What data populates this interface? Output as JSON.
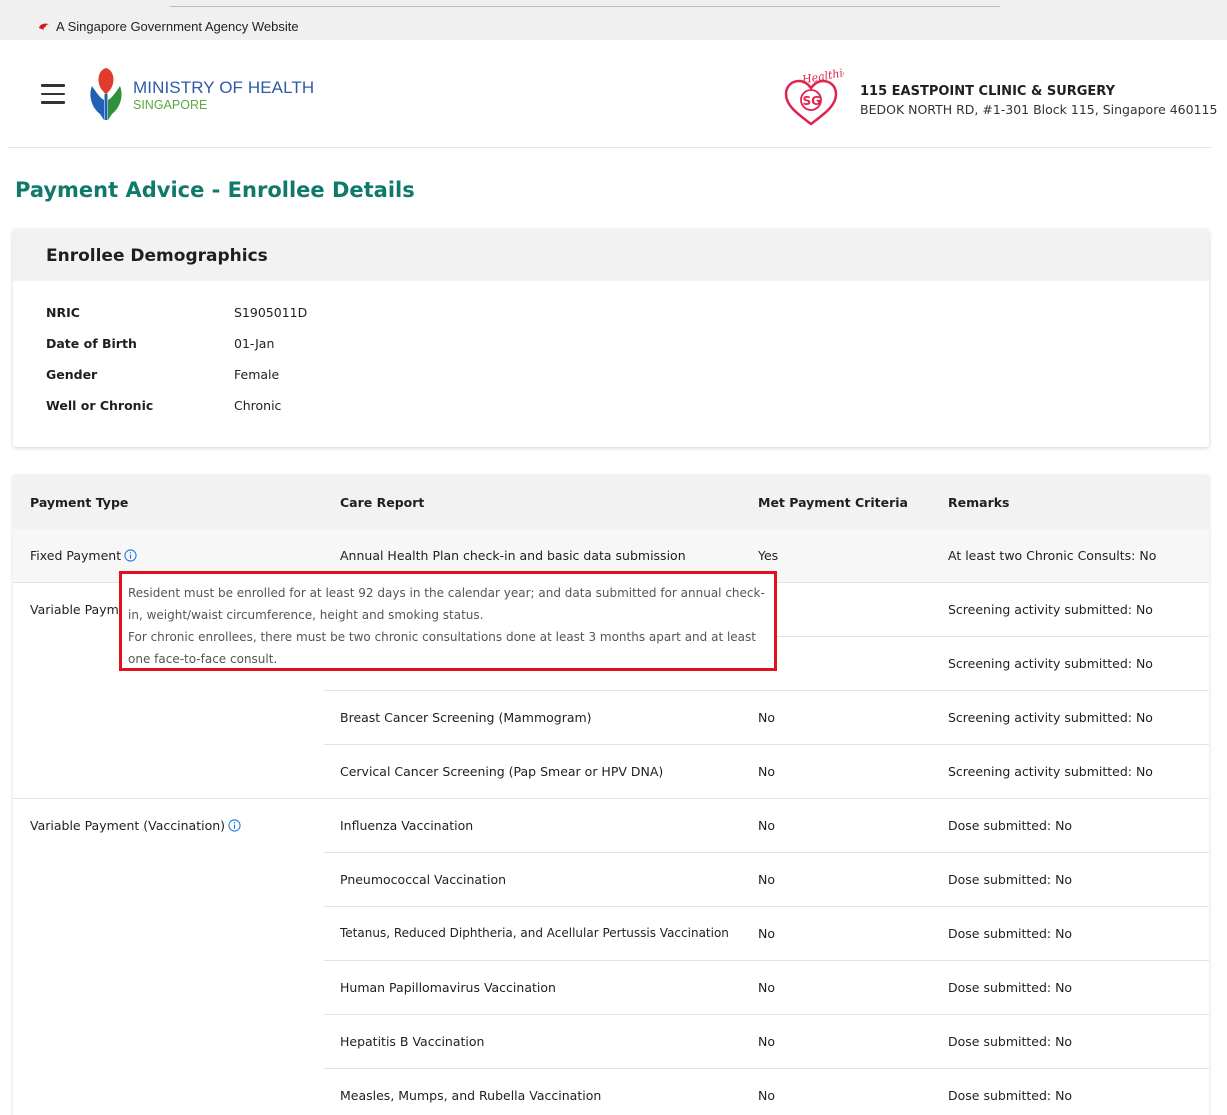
{
  "gov_banner": {
    "text": "A Singapore Government Agency Website"
  },
  "header": {
    "ministry_name": "MINISTRY OF HEALTH",
    "ministry_sub": "SINGAPORE",
    "healthier_logo_text": "Healthier",
    "healthier_logo_sg": "SG",
    "clinic_name": "115 EASTPOINT CLINIC & SURGERY",
    "clinic_address": "BEDOK NORTH RD, #1-301 Block 115, Singapore 460115"
  },
  "page_title": "Payment Advice - Enrollee Details",
  "demographics": {
    "title": "Enrollee Demographics",
    "fields": [
      {
        "label": "NRIC",
        "value": "S1905011D"
      },
      {
        "label": "Date of Birth",
        "value": "01-Jan"
      },
      {
        "label": "Gender",
        "value": "Female"
      },
      {
        "label": "Well or Chronic",
        "value": "Chronic"
      }
    ]
  },
  "table": {
    "headers": [
      "Payment Type",
      "Care Report",
      "Met Payment Criteria",
      "Remarks"
    ],
    "groups": [
      {
        "label": "Fixed Payment",
        "has_info": true
      },
      {
        "label": "Variable Payment",
        "has_info": true
      },
      {
        "label": "Variable Payment (Vaccination)",
        "has_info": true
      }
    ],
    "rows": [
      {
        "care_report": "Annual Health Plan check-in and basic data submission",
        "met": "Yes",
        "remarks": "At least two Chronic Consults: No"
      },
      {
        "care_report": "",
        "met": "",
        "remarks": "Screening activity submitted: No"
      },
      {
        "care_report": "",
        "met": "",
        "remarks": "Screening activity submitted: No"
      },
      {
        "care_report": "Breast Cancer Screening (Mammogram)",
        "met": "No",
        "remarks": "Screening activity submitted: No"
      },
      {
        "care_report": "Cervical Cancer Screening (Pap Smear or HPV DNA)",
        "met": "No",
        "remarks": "Screening activity submitted: No"
      },
      {
        "care_report": "Influenza Vaccination",
        "met": "No",
        "remarks": "Dose submitted: No"
      },
      {
        "care_report": "Pneumococcal Vaccination",
        "met": "No",
        "remarks": "Dose submitted: No"
      },
      {
        "care_report": "Tetanus, Reduced Diphtheria, and Acellular Pertussis Vaccination",
        "met": "No",
        "remarks": "Dose submitted: No"
      },
      {
        "care_report": "Human Papillomavirus Vaccination",
        "met": "No",
        "remarks": "Dose submitted: No"
      },
      {
        "care_report": "Hepatitis B Vaccination",
        "met": "No",
        "remarks": "Dose submitted: No"
      },
      {
        "care_report": "Measles, Mumps, and Rubella Vaccination",
        "met": "No",
        "remarks": "Dose submitted: No"
      }
    ]
  },
  "tooltip": {
    "line1": "Resident must be enrolled for at least 92 days in the calendar year; and data submitted for annual check-",
    "line2": "in, weight/waist circumference, height and smoking status.",
    "line3": "For chronic enrollees, there must be two chronic consultations done at least 3 months apart and at least",
    "line4": "one face-to-face consult."
  },
  "colors": {
    "title_teal": "#0f7a6c",
    "moh_blue": "#2e5aa8",
    "moh_green": "#5aa845",
    "highlight_red": "#e0101e",
    "info_blue": "#1a73e8"
  }
}
